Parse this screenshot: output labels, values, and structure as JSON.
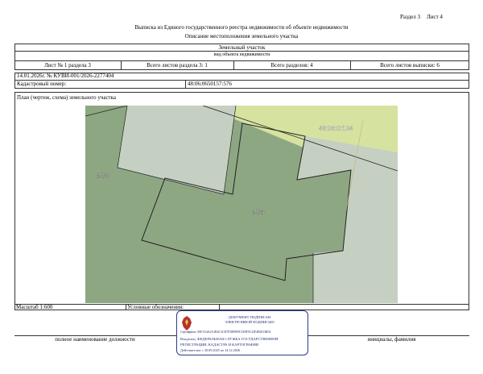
{
  "header": {
    "section_label": "Раздел 3",
    "sheet_label": "Лист 4",
    "title": "Выписка из Единого государственного реестра недвижимости об объекте недвижимости",
    "subtitle": "Описание местоположения земельного участка"
  },
  "object_block": {
    "object_type": "Земельный участок",
    "object_kind_caption": "вид объекта недвижимости",
    "sheet_number": "Лист № 1 раздела 3",
    "sheets_in_section": "Всего листов раздела 3: 1",
    "sections_total": "Всего разделов: 4",
    "sheets_total": "Всего листов выписки: 6"
  },
  "record": {
    "date_number": "14.01.2026г. № КУВИ-001/2026-2277404",
    "cadastral_label": "Кадастровый номер:",
    "cadastral_number": "48:06:0650157:576"
  },
  "plan": {
    "caption": "План (чертеж, схема) земельного участка",
    "labels": {
      "neighbor_left": ":575",
      "main_parcel": ":576",
      "neighbor_road": "48:06:0:134"
    },
    "colors": {
      "parcel_green": "#8ea783",
      "light_gray": "#c5d0c2",
      "road_yellow": "#d6e2a0",
      "boundary": "#222222"
    }
  },
  "footer": {
    "scale_label": "Масштаб 1:600",
    "legend_label": "Условные обозначения:",
    "position_caption": "полное наименование должности",
    "name_caption": "инициалы, фамилия"
  },
  "stamp": {
    "line1": "ДОКУМЕНТ ПОДПИСАН",
    "line2": "ЭЛЕКТРОННОЙ ПОДПИСЬЮ",
    "line3": "Сертификат: 00F1A4A2A1B4C3CD7F38F8F8C5E8F5C33F4E6E1BDA",
    "line4": "Владелец: ФЕДЕРАЛЬНАЯ СЛУЖБА ГОСУДАРСТВЕННОЙ",
    "line5": "РЕГИСТРАЦИИ, КАДАСТРА И КАРТОГРАФИИ",
    "line6": "Действителен: с 30.09.2025 по 14.12.2026",
    "emblem_color": "#b3342a"
  }
}
